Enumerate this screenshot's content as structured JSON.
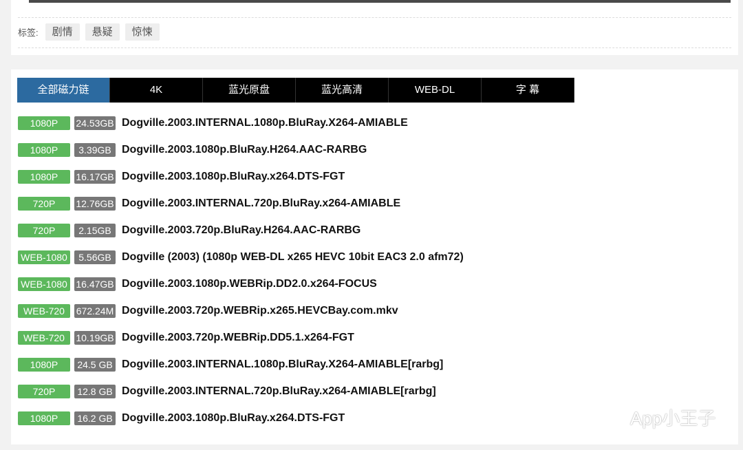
{
  "tags": {
    "label": "标签:",
    "items": [
      "剧情",
      "悬疑",
      "惊悚"
    ]
  },
  "tabs": [
    {
      "label": "全部磁力链",
      "active": true
    },
    {
      "label": "4K",
      "active": false
    },
    {
      "label": "蓝光原盘",
      "active": false
    },
    {
      "label": "蓝光高清",
      "active": false
    },
    {
      "label": "WEB-DL",
      "active": false
    },
    {
      "label": "字 幕",
      "active": false
    }
  ],
  "downloads": [
    {
      "quality": "1080P",
      "size": "24.53GB",
      "title": "Dogville.2003.INTERNAL.1080p.BluRay.X264-AMIABLE"
    },
    {
      "quality": "1080P",
      "size": "3.39GB",
      "title": "Dogville.2003.1080p.BluRay.H264.AAC-RARBG"
    },
    {
      "quality": "1080P",
      "size": "16.17GB",
      "title": "Dogville.2003.1080p.BluRay.x264.DTS-FGT"
    },
    {
      "quality": "720P",
      "size": "12.76GB",
      "title": "Dogville.2003.INTERNAL.720p.BluRay.x264-AMIABLE"
    },
    {
      "quality": "720P",
      "size": "2.15GB",
      "title": "Dogville.2003.720p.BluRay.H264.AAC-RARBG"
    },
    {
      "quality": "WEB-1080",
      "size": "5.56GB",
      "title": "Dogville (2003) (1080p WEB-DL x265 HEVC 10bit EAC3 2.0 afm72)"
    },
    {
      "quality": "WEB-1080",
      "size": "16.47GB",
      "title": "Dogville.2003.1080p.WEBRip.DD2.0.x264-FOCUS"
    },
    {
      "quality": "WEB-720",
      "size": "672.24M",
      "title": "Dogville.2003.720p.WEBRip.x265.HEVCBay.com.mkv"
    },
    {
      "quality": "WEB-720",
      "size": "10.19GB",
      "title": "Dogville.2003.720p.WEBRip.DD5.1.x264-FGT"
    },
    {
      "quality": "1080P",
      "size": "24.5 GB",
      "title": "Dogville.2003.INTERNAL.1080p.BluRay.X264-AMIABLE[rarbg]"
    },
    {
      "quality": "720P",
      "size": "12.8 GB",
      "title": "Dogville.2003.INTERNAL.720p.BluRay.x264-AMIABLE[rarbg]"
    },
    {
      "quality": "1080P",
      "size": "16.2 GB",
      "title": "Dogville.2003.1080p.BluRay.x264.DTS-FGT"
    }
  ],
  "watermark": {
    "text": "App小王子",
    "icon": "wechat-icon"
  },
  "colors": {
    "active_tab": "#2c6aa0",
    "tab_bg": "#000000",
    "quality_badge": "#5cb85c",
    "size_badge": "#777777"
  }
}
